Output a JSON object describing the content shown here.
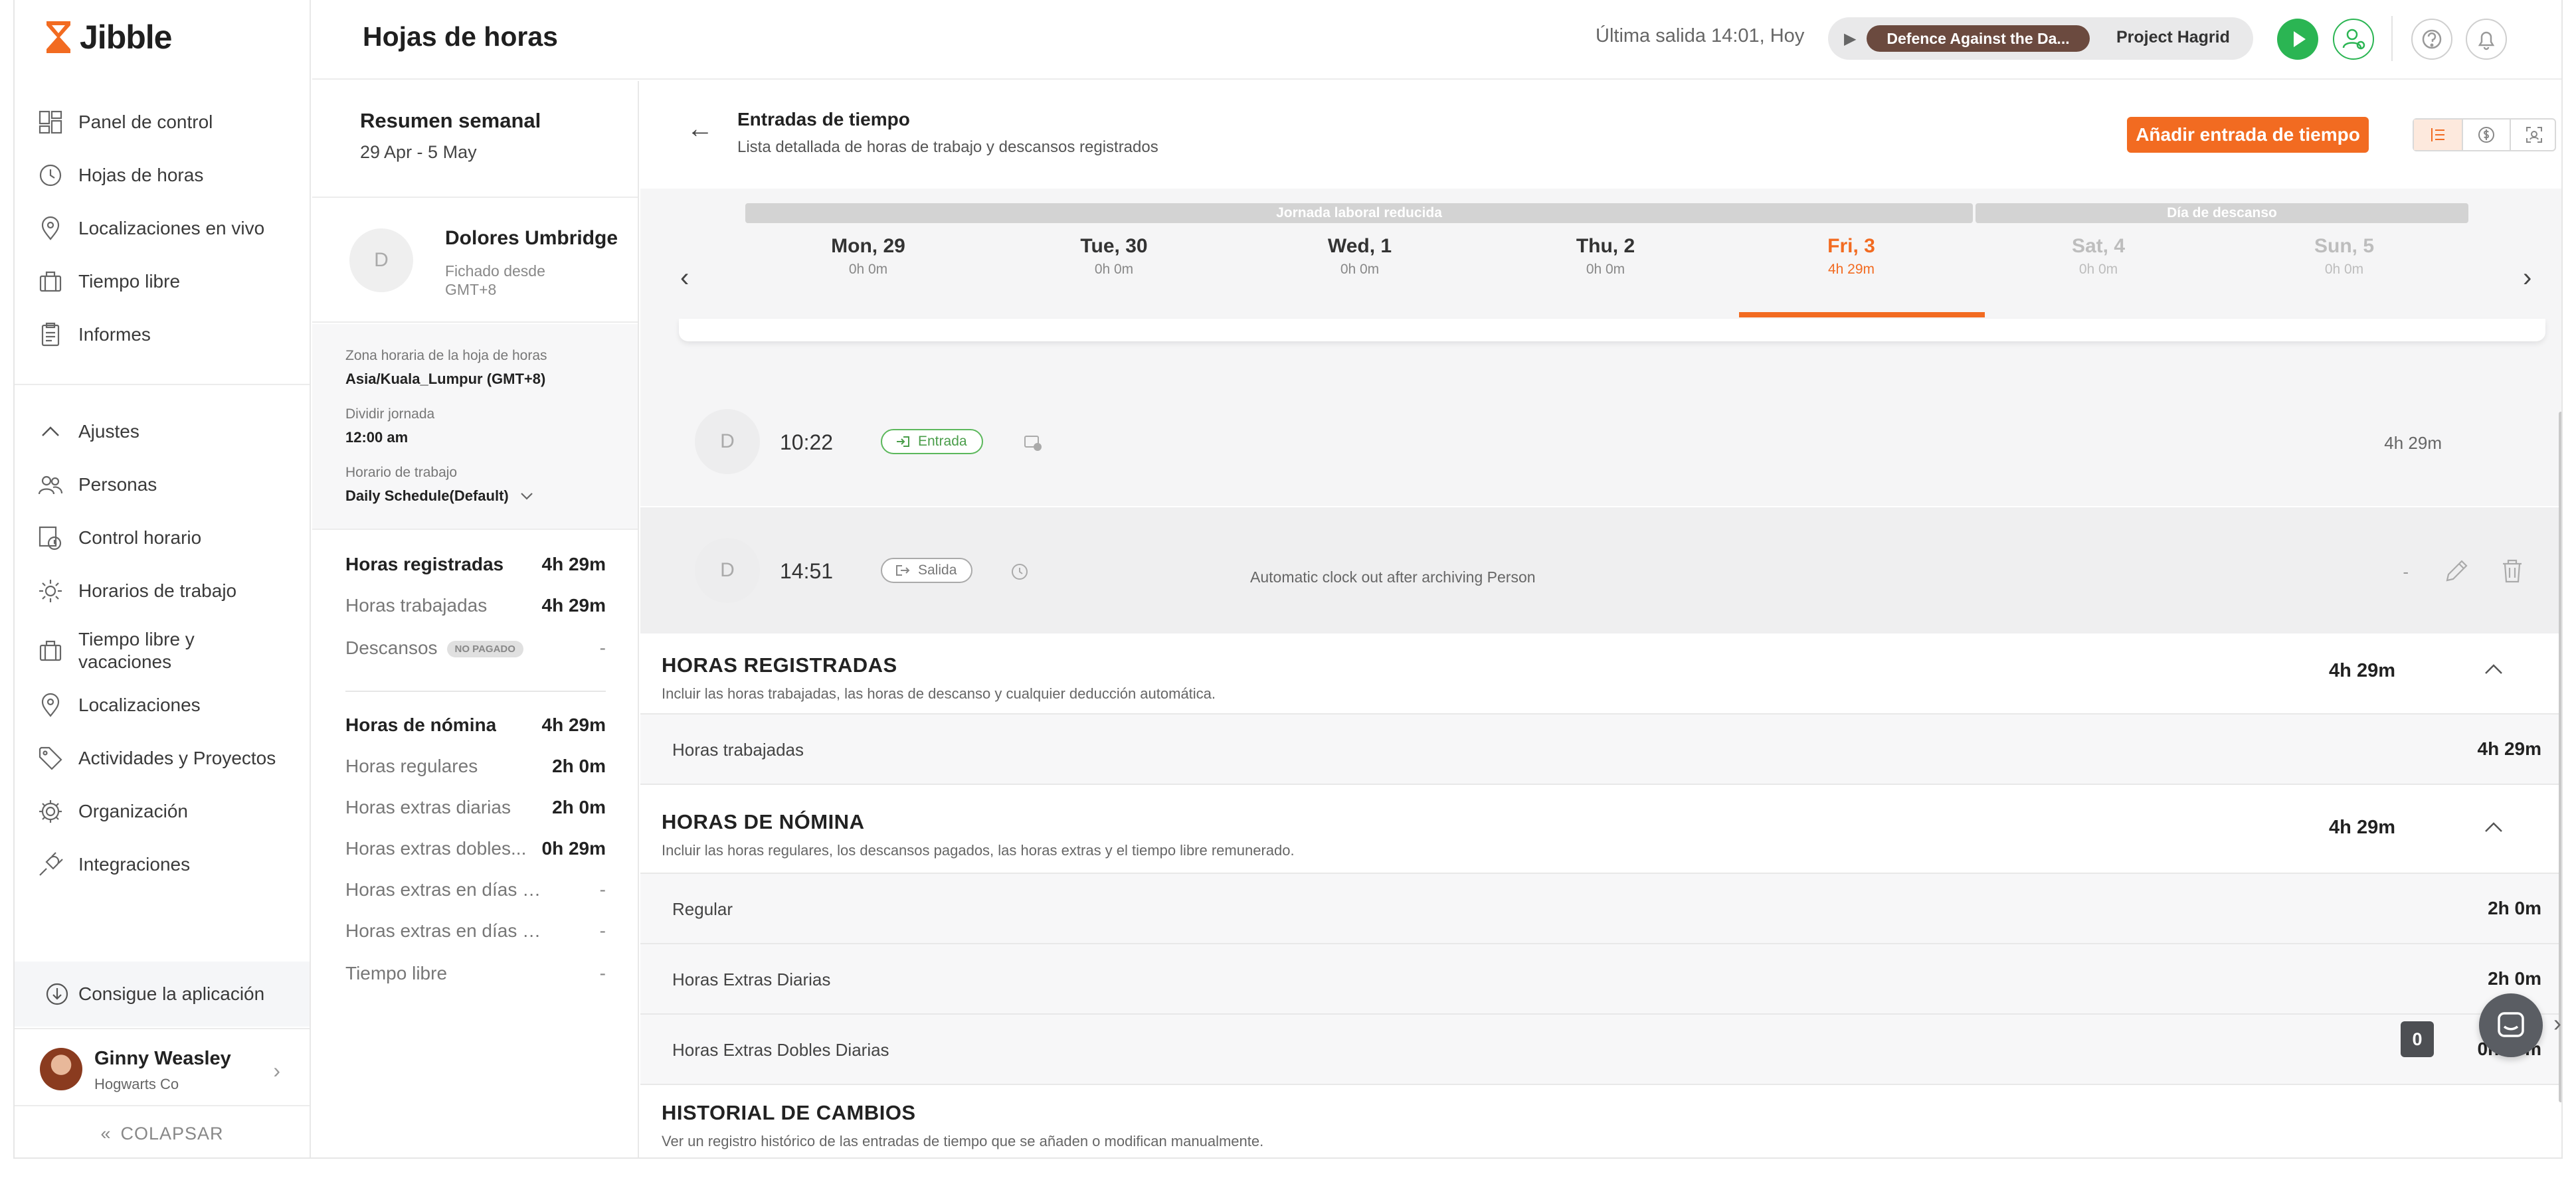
{
  "app": {
    "name": "Jibble"
  },
  "sidebar": {
    "items": [
      {
        "label": "Panel de control",
        "icon": "dashboard-icon"
      },
      {
        "label": "Hojas de horas",
        "icon": "clock-icon"
      },
      {
        "label": "Localizaciones en vivo",
        "icon": "map-pin-icon"
      },
      {
        "label": "Tiempo libre",
        "icon": "suitcase-icon"
      },
      {
        "label": "Informes",
        "icon": "clipboard-icon"
      }
    ],
    "settings_label": "Ajustes",
    "settings_items": [
      {
        "label": "Personas",
        "icon": "people-icon"
      },
      {
        "label": "Control horario",
        "icon": "time-tracking-icon"
      },
      {
        "label": "Horarios de trabajo",
        "icon": "sun-icon"
      },
      {
        "label": "Tiempo libre y vacaciones",
        "icon": "suitcase-icon"
      },
      {
        "label": "Localizaciones",
        "icon": "map-pin-icon"
      },
      {
        "label": "Actividades y Proyectos",
        "icon": "tag-icon"
      },
      {
        "label": "Organización",
        "icon": "gear-icon"
      },
      {
        "label": "Integraciones",
        "icon": "plug-icon"
      }
    ],
    "get_app": "Consigue la aplicación",
    "user": {
      "name": "Ginny Weasley",
      "org": "Hogwarts Co"
    },
    "collapse": "COLAPSAR"
  },
  "header": {
    "title": "Hojas de horas",
    "last_out": "Última salida 14:01, Hoy",
    "activity": "Defence Against the Da...",
    "project": "Project Hagrid"
  },
  "summary": {
    "title": "Resumen semanal",
    "range": "29 Apr - 5 May",
    "person": {
      "initial": "D",
      "name": "Dolores Umbridge",
      "since": "Fichado desde GMT+8"
    },
    "tz_label": "Zona horaria de la hoja de horas",
    "tz_value": "Asia/Kuala_Lumpur (GMT+8)",
    "split_label": "Dividir jornada",
    "split_value": "12:00 am",
    "schedule_label": "Horario de trabajo",
    "schedule_value": "Daily Schedule(Default)",
    "tracked": [
      {
        "label": "Horas registradas",
        "value": "4h 29m",
        "bold": true
      },
      {
        "label": "Horas trabajadas",
        "value": "4h 29m",
        "bold": false
      },
      {
        "label": "Descansos",
        "value": "-",
        "badge": "NO PAGADO",
        "bold": false
      }
    ],
    "payroll": [
      {
        "label": "Horas de nómina",
        "value": "4h 29m",
        "bold": true
      },
      {
        "label": "Horas regulares",
        "value": "2h 0m",
        "bold": false
      },
      {
        "label": "Horas extras diarias",
        "value": "2h 0m",
        "bold": false
      },
      {
        "label": "Horas extras dobles...",
        "value": "0h 29m",
        "bold": false
      },
      {
        "label": "Horas extras en días de de...",
        "value": "-",
        "bold": false
      },
      {
        "label": "Horas extras en días festiv...",
        "value": "-",
        "bold": false
      },
      {
        "label": "Tiempo libre",
        "value": "-",
        "bold": false
      }
    ]
  },
  "main": {
    "title": "Entradas de tiempo",
    "subtitle": "Lista detallada de horas de trabajo y descansos registrados",
    "add_button": "Añadir entrada de tiempo",
    "bands": {
      "reduced": "Jornada laboral reducida",
      "rest": "Día de descanso"
    },
    "days": [
      {
        "name": "Mon, 29",
        "hours": "0h 0m",
        "state": "normal"
      },
      {
        "name": "Tue, 30",
        "hours": "0h 0m",
        "state": "normal"
      },
      {
        "name": "Wed, 1",
        "hours": "0h 0m",
        "state": "normal"
      },
      {
        "name": "Thu, 2",
        "hours": "0h 0m",
        "state": "normal"
      },
      {
        "name": "Fri, 3",
        "hours": "4h 29m",
        "state": "active"
      },
      {
        "name": "Sat, 4",
        "hours": "0h 0m",
        "state": "muted"
      },
      {
        "name": "Sun, 5",
        "hours": "0h 0m",
        "state": "muted"
      }
    ],
    "entries": [
      {
        "initial": "D",
        "time": "10:22",
        "type": "Entrada",
        "note": "",
        "duration": "4h 29m"
      },
      {
        "initial": "D",
        "time": "14:51",
        "type": "Salida",
        "note": "Automatic clock out after archiving Person",
        "duration": "-"
      }
    ],
    "tracked_section": {
      "title": "HORAS REGISTRADAS",
      "subtitle": "Incluir las horas trabajadas, las horas de descanso y cualquier deducción automática.",
      "value": "4h 29m",
      "rows": [
        {
          "label": "Horas trabajadas",
          "value": "4h 29m"
        }
      ]
    },
    "payroll_section": {
      "title": "HORAS DE NÓMINA",
      "subtitle": "Incluir las horas regulares, los descansos pagados, las horas extras y el tiempo libre remunerado.",
      "value": "4h 29m",
      "rows": [
        {
          "label": "Regular",
          "value": "2h 0m"
        },
        {
          "label": "Horas Extras Diarias",
          "value": "2h 0m"
        },
        {
          "label": "Horas Extras Dobles Diarias",
          "value": "0h 29m"
        }
      ]
    },
    "history_section": {
      "title": "HISTORIAL DE CAMBIOS",
      "subtitle": "Ver un registro histórico de las entradas de tiempo que se añaden o modifican manualmente.",
      "count": "0"
    }
  },
  "colors": {
    "accent": "#f26b21",
    "success": "#2bb553",
    "activity_tag": "#6b4a3f"
  }
}
